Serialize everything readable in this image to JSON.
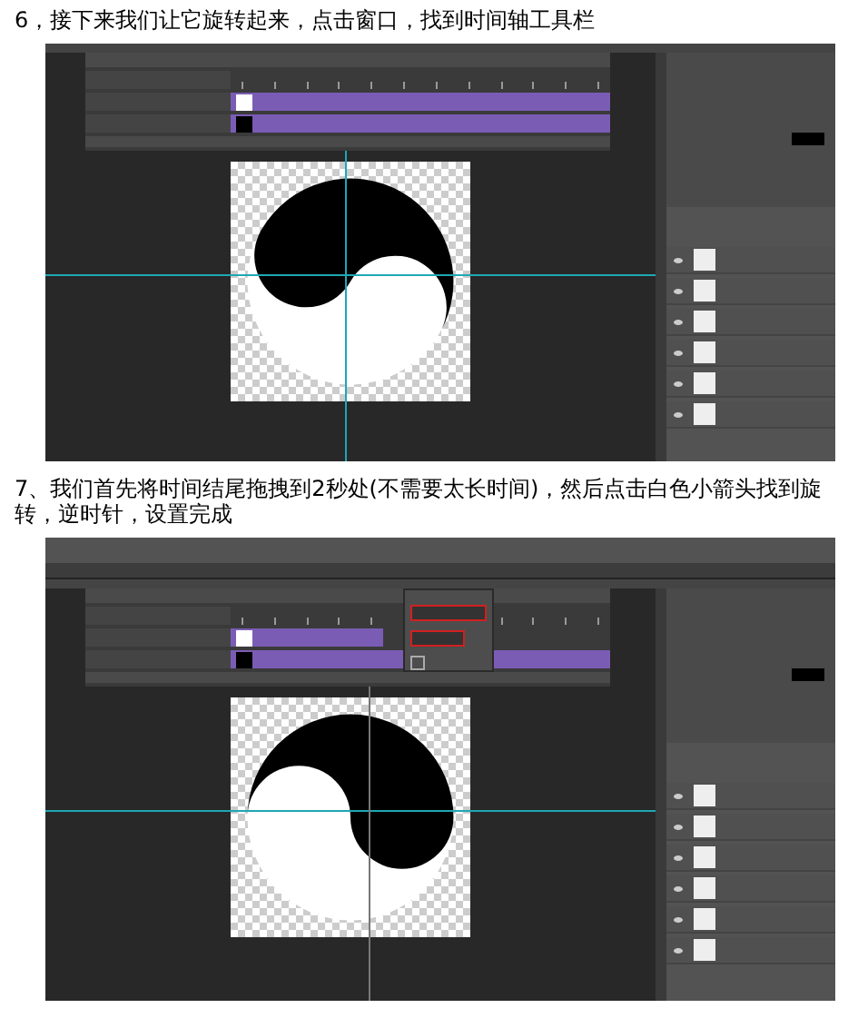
{
  "steps": [
    {
      "text": "6，接下来我们让它旋转起来，点击窗口，找到时间轴工具栏",
      "screenshot": {
        "popup_open": false,
        "clip_trimmed": false,
        "tilt": true
      }
    },
    {
      "text": "7、我们首先将时间结尾拖拽到2秒处(不需要太长时间)，然后点击白色小箭头找到旋转，逆时针，设置完成",
      "screenshot": {
        "popup_open": true,
        "clip_trimmed": true,
        "tilt": false
      }
    }
  ]
}
